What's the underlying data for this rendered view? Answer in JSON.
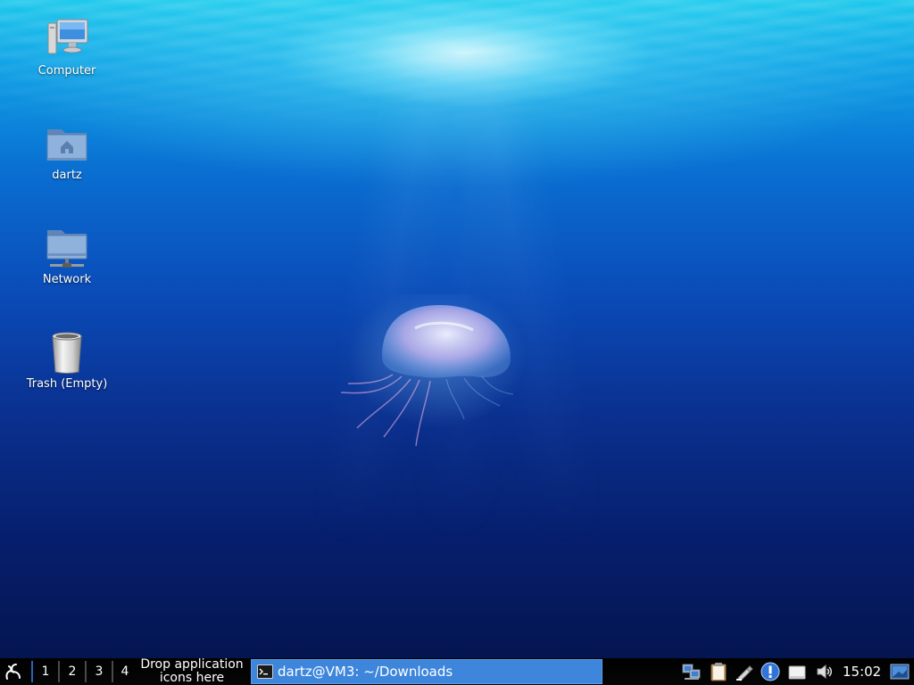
{
  "desktop": {
    "icons": [
      {
        "label": "Computer",
        "icon": "computer-icon"
      },
      {
        "label": "dartz",
        "icon": "home-folder-icon"
      },
      {
        "label": "Network",
        "icon": "network-folder-icon"
      },
      {
        "label": "Trash (Empty)",
        "icon": "trash-icon"
      }
    ]
  },
  "taskbar": {
    "menu_icon": "start-menu-icon",
    "workspaces": [
      "1",
      "2",
      "3",
      "4"
    ],
    "active_workspace": "1",
    "launcher_hint": "Drop application icons here",
    "task": {
      "title": "dartz@VM3: ~/Downloads",
      "icon": "terminal-icon"
    },
    "tray": [
      "network-icon",
      "clipboard-icon",
      "edit-tool-icon",
      "update-notifier-icon",
      "removable-drive-icon",
      "volume-icon"
    ],
    "clock": "15:02",
    "show_desktop_icon": "show-desktop-icon"
  },
  "colors": {
    "taskbar_bg": "#000000",
    "task_active": "#3d86dc",
    "workspace_active_marker": "#2a62b8"
  }
}
